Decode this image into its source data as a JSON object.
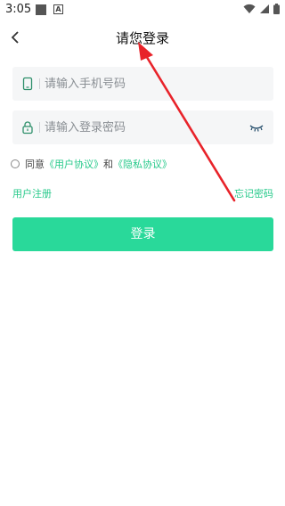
{
  "status_bar": {
    "time": "3:05",
    "icons": [
      "notification-square-icon",
      "a-icon",
      "wifi-icon",
      "signal-icon",
      "battery-icon"
    ]
  },
  "header": {
    "title": "请您登录",
    "back_icon": "chevron-left-icon"
  },
  "phone_field": {
    "placeholder": "请输入手机号码",
    "value": "",
    "icon": "phone-icon"
  },
  "password_field": {
    "placeholder": "请输入登录密码",
    "value": "",
    "icon": "lock-icon",
    "toggle_icon": "eye-closed-icon"
  },
  "agreement": {
    "prefix": "同意",
    "user_agreement": "《用户协议》",
    "and": "和",
    "privacy_policy": "《隐私协议》",
    "checked": false
  },
  "links": {
    "register": "用户注册",
    "forgot_password": "忘记密码"
  },
  "login_button": {
    "label": "登录"
  },
  "colors": {
    "accent": "#26c98a",
    "button": "#29d99a",
    "field_bg": "#f5f6f7",
    "annotation_arrow": "#e8232a"
  }
}
